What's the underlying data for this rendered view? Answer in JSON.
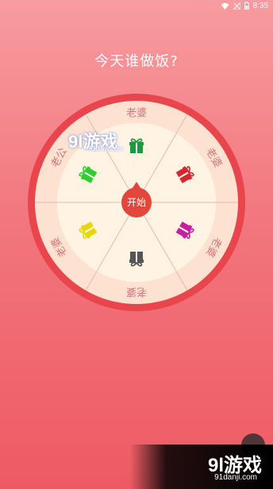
{
  "status_bar": {
    "time": "8:35"
  },
  "title": "今天谁做饭?",
  "wheel": {
    "start_label": "开始",
    "colors": {
      "rim": "#e8454d",
      "face_outer": "#fde2d2",
      "face_inner": "#fff3e4",
      "hub": "#e3473c"
    },
    "segments": [
      {
        "label": "老婆",
        "gift_color": "#1a9c3c",
        "gift_icon": "gift-icon"
      },
      {
        "label": "老婆",
        "gift_color": "#d8262c",
        "gift_icon": "gift-icon"
      },
      {
        "label": "老婆",
        "gift_color": "#c71f9d",
        "gift_icon": "gift-icon"
      },
      {
        "label": "老婆",
        "gift_color": "#555555",
        "gift_icon": "gift-icon"
      },
      {
        "label": "老婆",
        "gift_color": "#e6d60b",
        "gift_icon": "gift-icon"
      },
      {
        "label": "老公",
        "gift_color": "#33cc33",
        "gift_icon": "gift-icon"
      }
    ]
  },
  "watermark": {
    "brand": "9l游戏",
    "site": "91danji.com"
  }
}
